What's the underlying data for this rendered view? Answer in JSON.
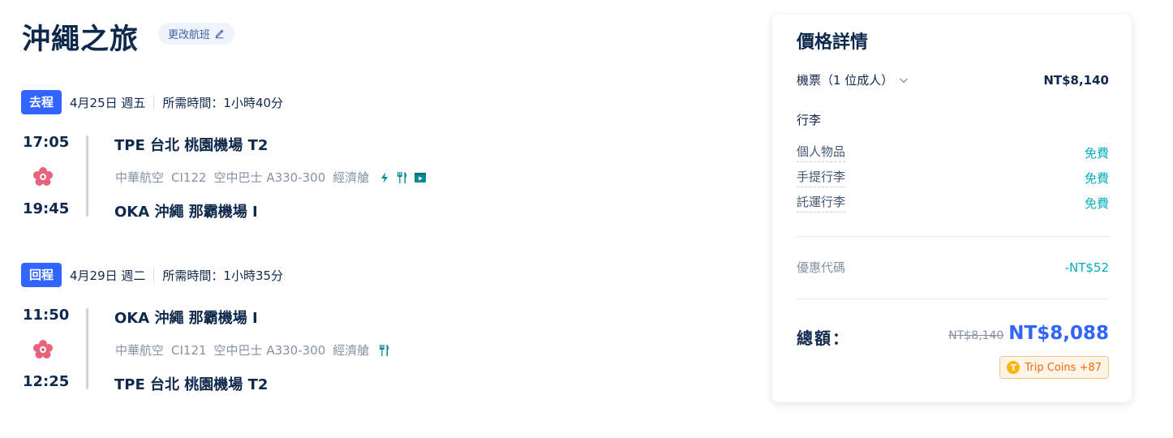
{
  "trip": {
    "title": "沖繩之旅",
    "change_label": "更改航班"
  },
  "legs": [
    {
      "tag": "去程",
      "date": "4月25日 週五",
      "duration": "所需時間：1小時40分",
      "dep_time": "17:05",
      "dep_airport": "TPE 台北 桃園機場 T2",
      "arr_time": "19:45",
      "arr_airport": "OKA 沖繩 那霸機場 I",
      "airline": "中華航空",
      "flight_no": "CI122",
      "aircraft": "空中巴士 A330-300",
      "cabin": "經濟艙",
      "amenities": [
        "power-icon",
        "meal-icon",
        "entertainment-icon"
      ]
    },
    {
      "tag": "回程",
      "date": "4月29日 週二",
      "duration": "所需時間：1小時35分",
      "dep_time": "11:50",
      "dep_airport": "OKA 沖繩 那霸機場 I",
      "arr_time": "12:25",
      "arr_airport": "TPE 台北 桃園機場 T2",
      "airline": "中華航空",
      "flight_no": "CI121",
      "aircraft": "空中巴士 A330-300",
      "cabin": "經濟艙",
      "amenities": [
        "meal-icon"
      ]
    }
  ],
  "price": {
    "title": "價格詳情",
    "ticket_label": "機票（1 位成人）",
    "ticket_price": "NT$8,140",
    "baggage_title": "行李",
    "baggage": [
      {
        "name": "個人物品",
        "value": "免費"
      },
      {
        "name": "手提行李",
        "value": "免費"
      },
      {
        "name": "託運行李",
        "value": "免費"
      }
    ],
    "promo_label": "優惠代碼",
    "promo_value": "-NT$52",
    "total_label": "總額：",
    "original_total": "NT$8,140",
    "total": "NT$8,088",
    "coins": "Trip Coins +87"
  },
  "colors": {
    "accent": "#3264ff",
    "free": "#06aebd",
    "coins": "#f06a00",
    "text": "#0f294d"
  }
}
